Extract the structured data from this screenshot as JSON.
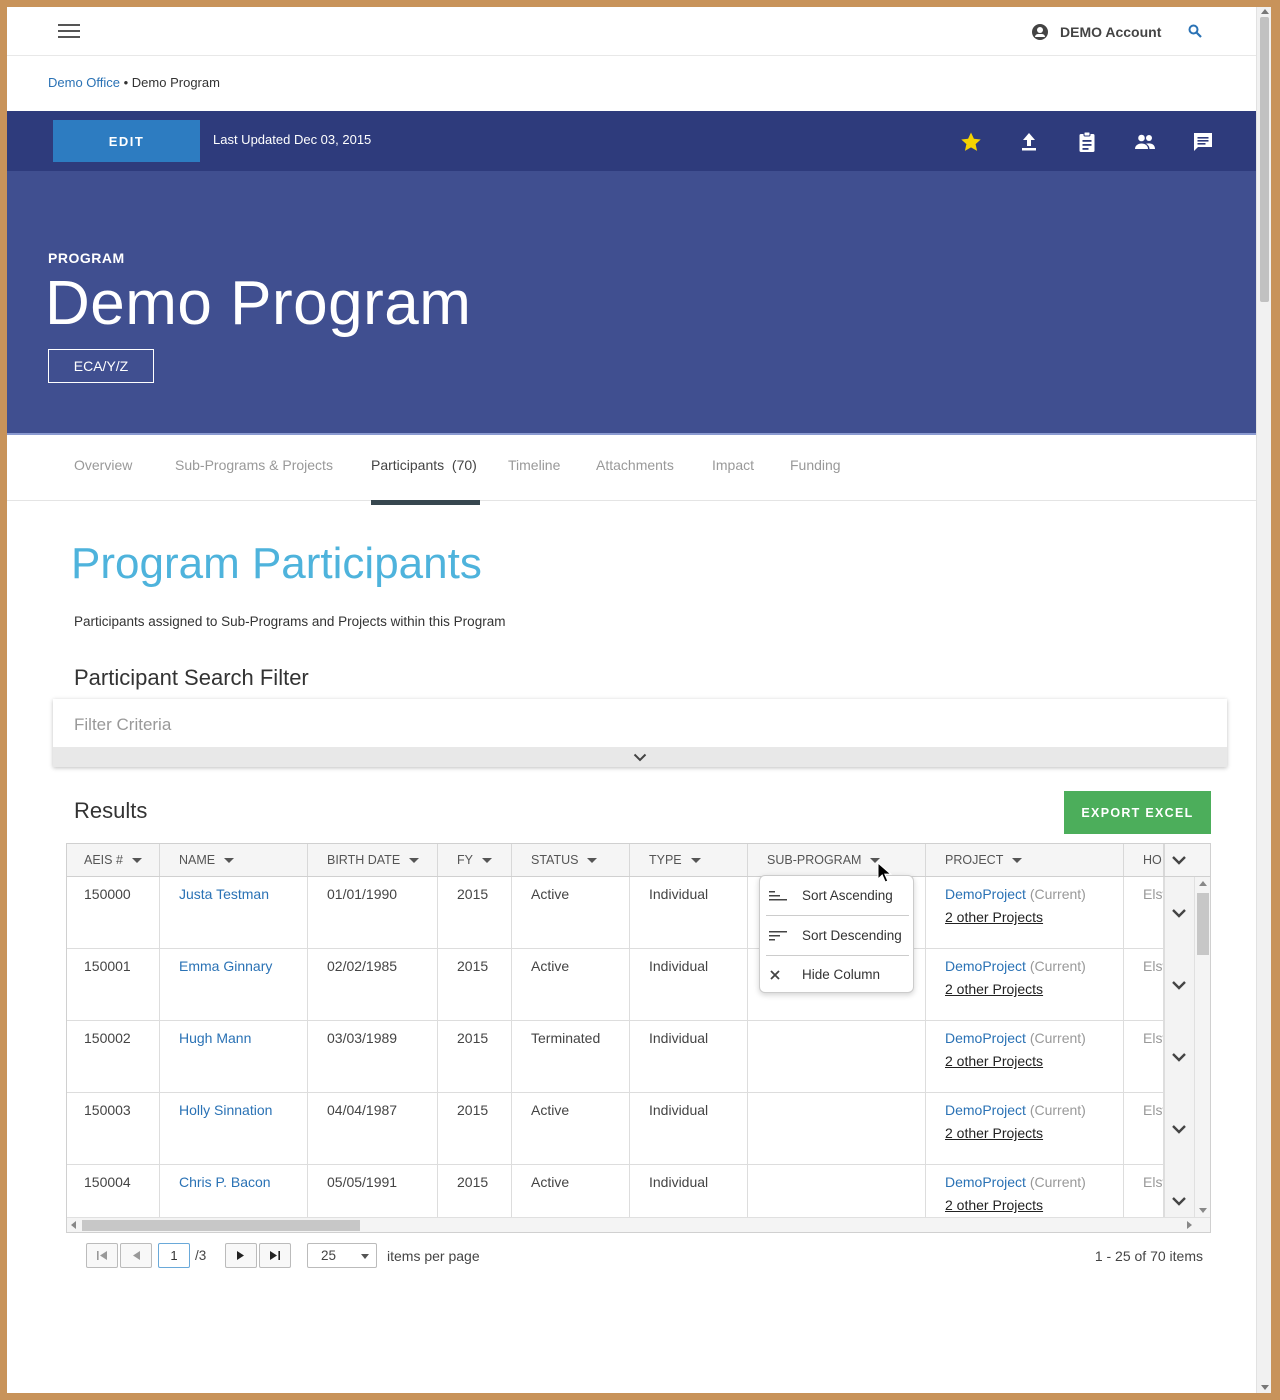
{
  "topbar": {
    "account_label": "DEMO Account"
  },
  "breadcrumb": {
    "office": "Demo Office",
    "separator": " • ",
    "program": "Demo Program"
  },
  "toolbar": {
    "edit_label": "EDIT",
    "last_updated": "Last Updated Dec 03, 2015",
    "icons": [
      "star-icon",
      "upload-icon",
      "clipboard-icon",
      "people-icon",
      "comment-icon"
    ]
  },
  "hero": {
    "kicker": "PROGRAM",
    "title": "Demo Program",
    "tag": "ECA/Y/Z"
  },
  "tabs": [
    {
      "label": "Overview"
    },
    {
      "label": "Sub-Programs & Projects"
    },
    {
      "label": "Participants  (70)"
    },
    {
      "label": "Timeline"
    },
    {
      "label": "Attachments"
    },
    {
      "label": "Impact"
    },
    {
      "label": "Funding"
    }
  ],
  "section": {
    "title": "Program Participants",
    "description": "Participants assigned to Sub-Programs and Projects within this Program"
  },
  "filter": {
    "title": "Participant Search Filter",
    "placeholder": "Filter Criteria"
  },
  "results": {
    "title": "Results",
    "export_label": "EXPORT EXCEL"
  },
  "grid": {
    "columns": [
      "AEIS #",
      "NAME",
      "BIRTH DATE",
      "FY",
      "STATUS",
      "TYPE",
      "SUB-PROGRAM",
      "PROJECT",
      "HO"
    ],
    "rows": [
      {
        "aeis": "150000",
        "name": "Justa Testman",
        "birth": "01/01/1990",
        "fy": "2015",
        "status": "Active",
        "type": "Individual",
        "subprogram": "",
        "project": "DemoProject",
        "project_state": "(Current)",
        "other": "2 other Projects",
        "ho": "Elsw"
      },
      {
        "aeis": "150001",
        "name": "Emma Ginnary",
        "birth": "02/02/1985",
        "fy": "2015",
        "status": "Active",
        "type": "Individual",
        "subprogram": "",
        "project": "DemoProject",
        "project_state": "(Current)",
        "other": "2 other Projects",
        "ho": "Elsw"
      },
      {
        "aeis": "150002",
        "name": "Hugh Mann",
        "birth": "03/03/1989",
        "fy": "2015",
        "status": "Terminated",
        "type": "Individual",
        "subprogram": "",
        "project": "DemoProject",
        "project_state": "(Current)",
        "other": "2 other Projects",
        "ho": "Elsw"
      },
      {
        "aeis": "150003",
        "name": "Holly Sinnation",
        "birth": "04/04/1987",
        "fy": "2015",
        "status": "Active",
        "type": "Individual",
        "subprogram": "",
        "project": "DemoProject",
        "project_state": "(Current)",
        "other": "2 other Projects",
        "ho": "Elsw"
      },
      {
        "aeis": "150004",
        "name": "Chris P. Bacon",
        "birth": "05/05/1991",
        "fy": "2015",
        "status": "Active",
        "type": "Individual",
        "subprogram": "",
        "project": "DemoProject",
        "project_state": "(Current)",
        "other": "2 other Projects",
        "ho": "Elsw"
      }
    ]
  },
  "column_menu": {
    "items": [
      "Sort Ascending",
      "Sort Descending",
      "Hide Column"
    ]
  },
  "pager": {
    "current_page": "1",
    "total_pages": "/3",
    "page_size": "25",
    "page_size_label": "items per page",
    "info": "1 - 25 of 70 items"
  }
}
